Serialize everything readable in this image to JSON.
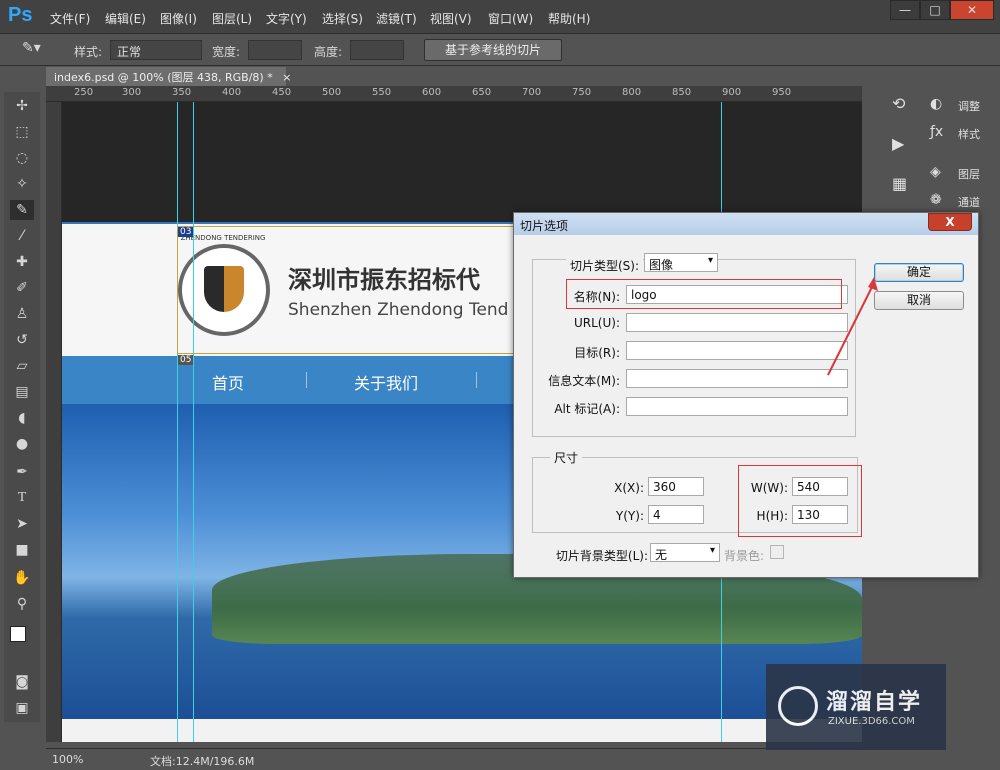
{
  "app": {
    "logo": "Ps",
    "menu": [
      "文件(F)",
      "编辑(E)",
      "图像(I)",
      "图层(L)",
      "文字(Y)",
      "选择(S)",
      "滤镜(T)",
      "视图(V)",
      "窗口(W)",
      "帮助(H)"
    ],
    "window_controls": [
      "—",
      "□",
      "✕"
    ]
  },
  "options_bar": {
    "style_label": "样式:",
    "style_value": "正常",
    "width_label": "宽度:",
    "height_label": "高度:",
    "guides_button": "基于参考线的切片"
  },
  "document": {
    "tab_title": "index6.psd @ 100% (图层 438, RGB/8) *",
    "ruler_ticks": [
      "250",
      "300",
      "350",
      "400",
      "450",
      "500",
      "550",
      "600",
      "650",
      "700",
      "750",
      "800",
      "850",
      "900",
      "950"
    ]
  },
  "canvas_content": {
    "logo_text": "ZHENDONG TENDERING",
    "company_cn": "深圳市振东招标代",
    "company_en": "Shenzhen Zhendong Tend",
    "nav": [
      "首页",
      "关于我们"
    ],
    "slice_badges": [
      "03",
      "05"
    ]
  },
  "right_panels": {
    "items": [
      "调整",
      "样式",
      "图层",
      "通道"
    ]
  },
  "status": {
    "zoom": "100%",
    "doc_size": "文档:12.4M/196.6M"
  },
  "dialog": {
    "title": "切片选项",
    "close_label": "X",
    "slice_type_label": "切片类型(S):",
    "slice_type_value": "图像",
    "name_label": "名称(N):",
    "name_value": "logo",
    "url_label": "URL(U):",
    "target_label": "目标(R):",
    "message_label": "信息文本(M):",
    "alt_label": "Alt 标记(A):",
    "dimensions_legend": "尺寸",
    "x_label": "X(X):",
    "x_value": "360",
    "y_label": "Y(Y):",
    "y_value": "4",
    "w_label": "W(W):",
    "w_value": "540",
    "h_label": "H(H):",
    "h_value": "130",
    "bg_type_label": "切片背景类型(L):",
    "bg_type_value": "无",
    "bg_color_label": "背景色:",
    "ok_button": "确定",
    "cancel_button": "取消"
  },
  "watermark": {
    "cn": "溜溜自学",
    "en": "ZIXUE.3D66.COM"
  },
  "colors": {
    "ps_blue": "#31a8ff",
    "nav_blue": "#3a85c6",
    "highlight_red": "#d9393b",
    "guide_cyan": "#3ad0e6"
  }
}
